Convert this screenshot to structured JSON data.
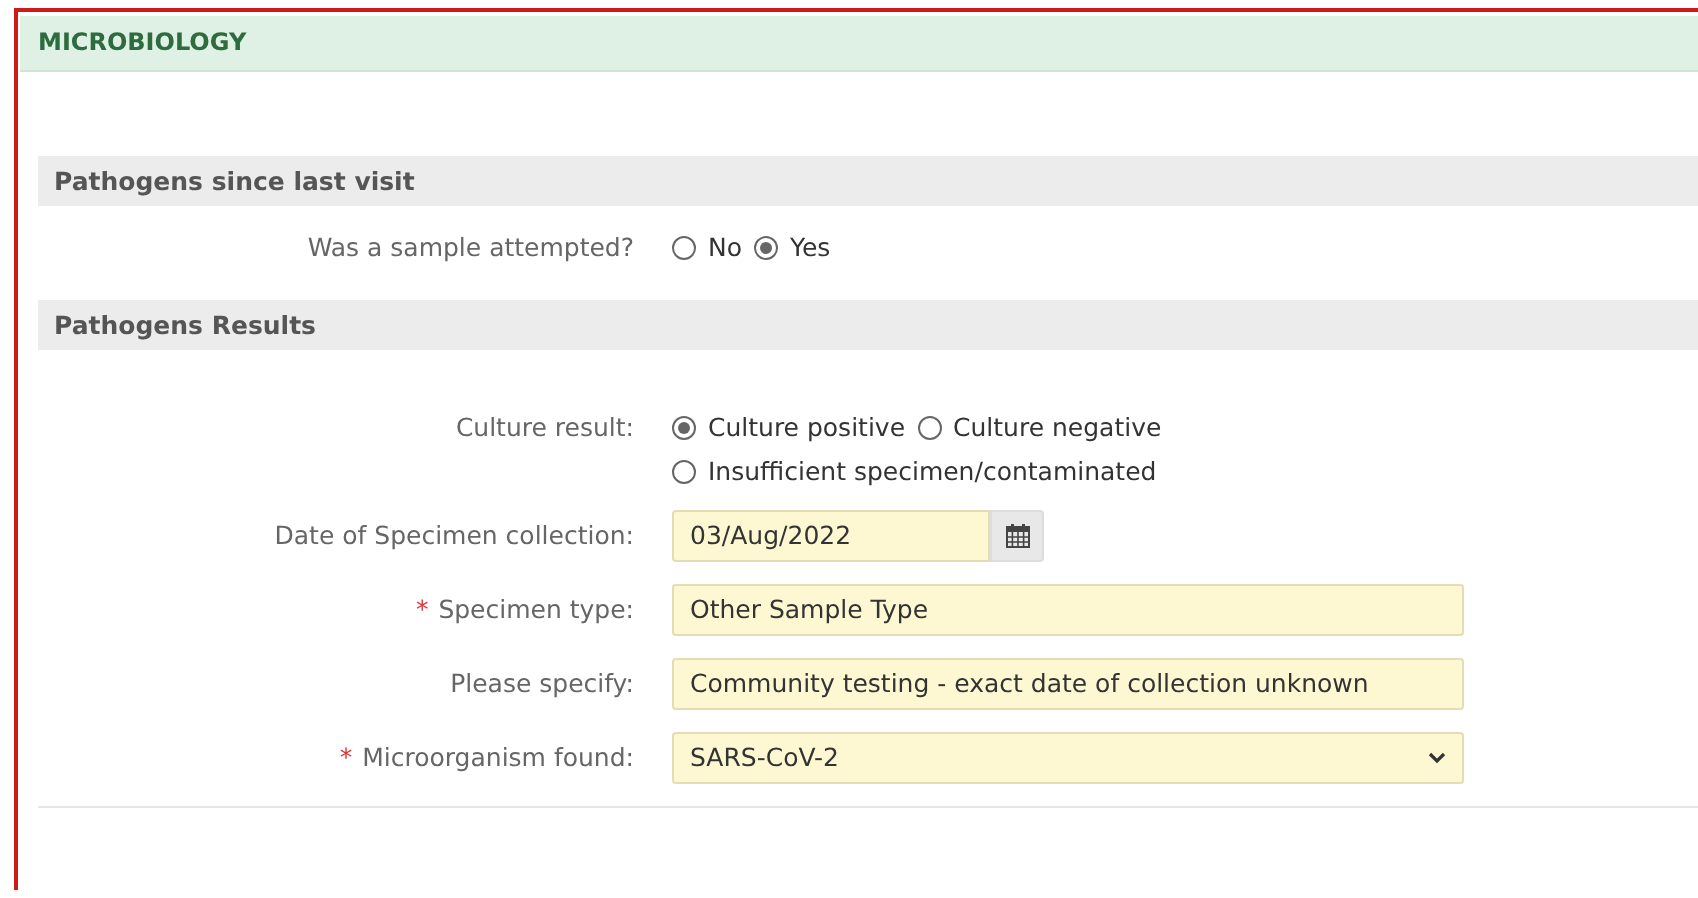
{
  "section": {
    "title": "MICROBIOLOGY"
  },
  "groups": [
    {
      "title": "Pathogens since last visit",
      "fields": [
        {
          "kind": "radio",
          "label": "Was a sample attempted?",
          "options": [
            {
              "label": "No",
              "selected": false
            },
            {
              "label": "Yes",
              "selected": true
            }
          ]
        }
      ]
    },
    {
      "title": "Pathogens Results",
      "fields": [
        {
          "kind": "radio",
          "label": "Culture result:",
          "options": [
            {
              "label": "Culture positive",
              "selected": true
            },
            {
              "label": "Culture negative",
              "selected": false
            },
            {
              "label": "Insufficient specimen/contaminated",
              "selected": false
            }
          ]
        },
        {
          "kind": "date",
          "label": "Date of Specimen collection:",
          "value": "03/Aug/2022"
        },
        {
          "kind": "text",
          "mark": "*",
          "label": "Specimen type:",
          "value": "Other Sample Type"
        },
        {
          "kind": "text",
          "label": "Please specify:",
          "value": "Community testing - exact date of collection unknown"
        },
        {
          "kind": "select",
          "mark": "*",
          "label": "Microorganism found:",
          "value": "SARS-CoV-2"
        }
      ]
    }
  ]
}
